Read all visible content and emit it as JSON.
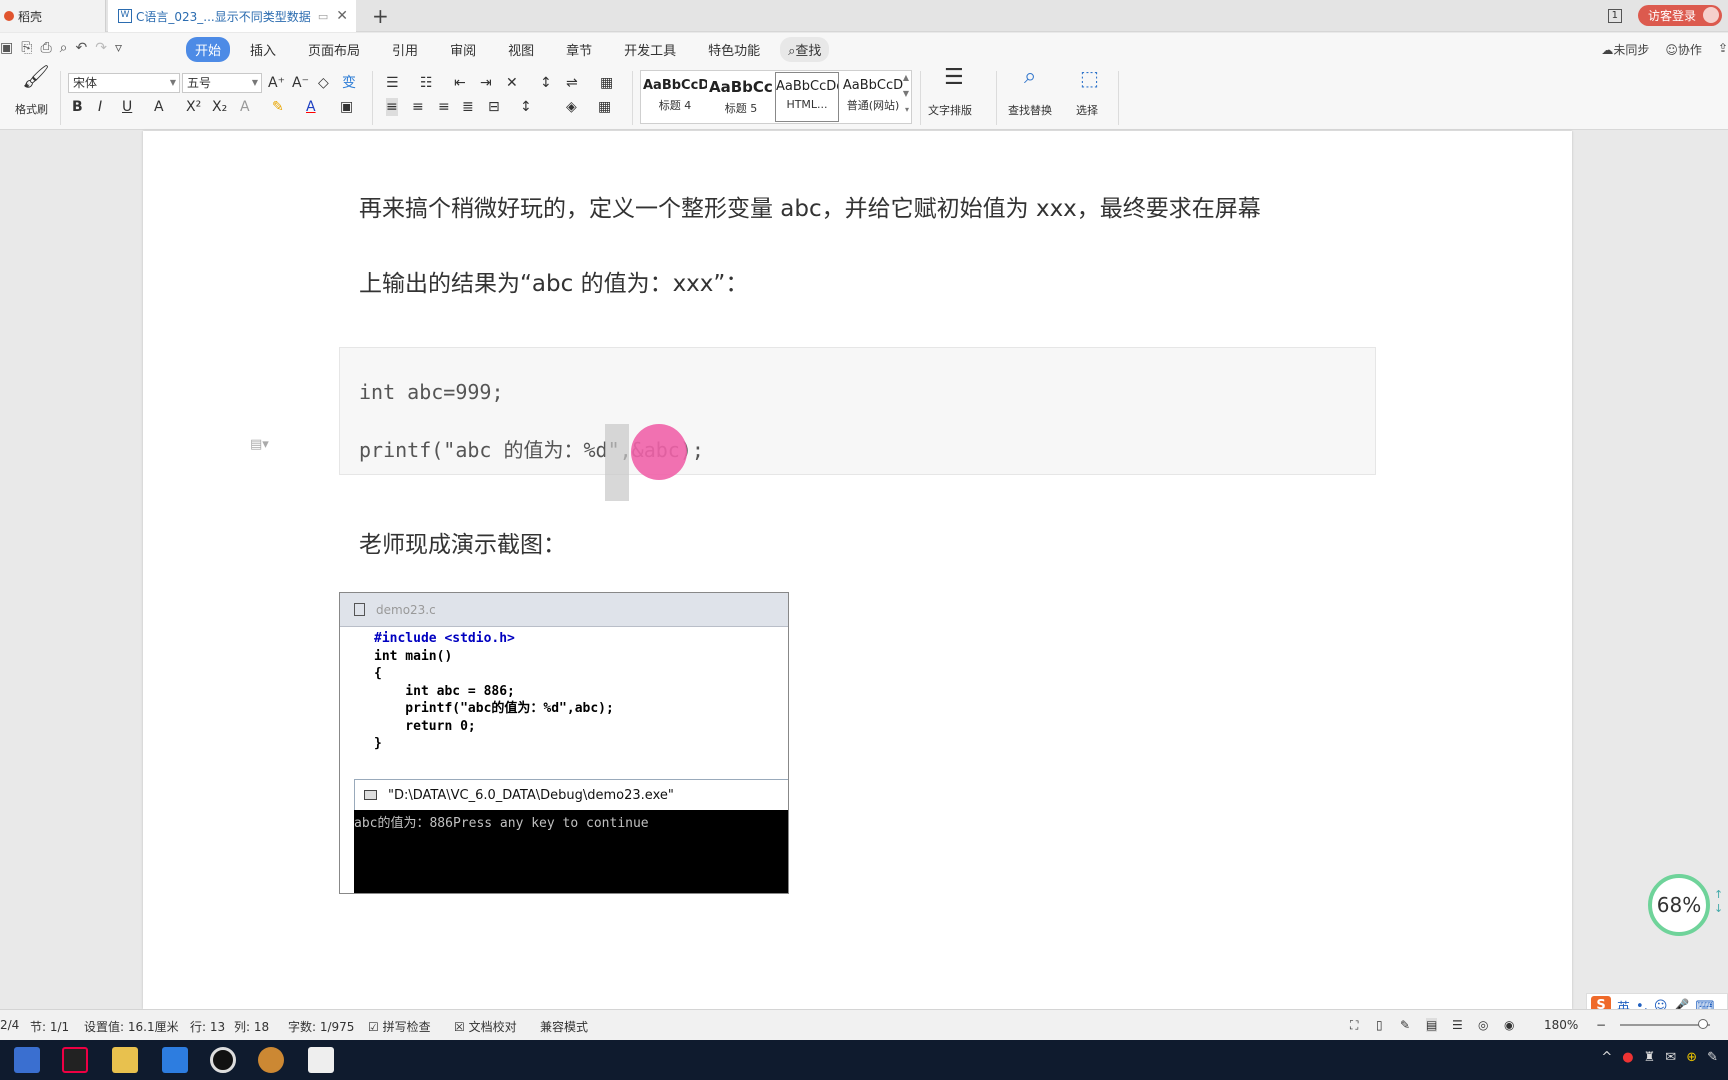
{
  "tabs": {
    "home": "稻壳",
    "doc": "C语言_023_...显示不同类型数据",
    "new": "+"
  },
  "topright": {
    "page_count": "1",
    "login": "访客登录"
  },
  "menubar": {
    "items": [
      "开始",
      "插入",
      "页面布局",
      "引用",
      "审阅",
      "视图",
      "章节",
      "开发工具",
      "特色功能"
    ],
    "search": "查找",
    "sync": "未同步",
    "collab": "协作"
  },
  "ribbon": {
    "format_painter": "格式刷",
    "font_name": "宋体",
    "font_size": "五号",
    "styles": [
      {
        "preview": "AaBbCcDd",
        "name": "标题 4"
      },
      {
        "preview": "AaBbCcDd",
        "name": "标题 5"
      },
      {
        "preview": "AaBbCcDd",
        "name": "HTML..."
      },
      {
        "preview": "AaBbCcD",
        "name": "普通(网站)"
      }
    ],
    "text_layout": "文字排版",
    "find_replace": "查找替换",
    "select": "选择"
  },
  "document": {
    "para1": "再来搞个稍微好玩的，定义一个整形变量 abc，并给它赋初始值为 xxx，最终要求在屏幕",
    "para2": "上输出的结果为“abc 的值为：xxx”：",
    "code_line1": "int abc=999;",
    "code_line2": "printf(\"abc 的值为：%d\",&abc);",
    "para3": "老师现成演示截图：",
    "screenshot": {
      "file_title": "demo23.c",
      "code": [
        "#include <stdio.h>",
        "int main()",
        "{",
        "    int abc = 886;",
        "    printf(\"abc的值为：%d\",abc);",
        "    return 0;",
        "}"
      ],
      "console_title": "\"D:\\DATA\\VC_6.0_DATA\\Debug\\demo23.exe\"",
      "console_output": "abc的值为：886Press any key to continue"
    }
  },
  "zoom_badge": "68%",
  "status": {
    "page": "2/4",
    "section": "节: 1/1",
    "setting": "设置值: 16.1厘米",
    "row": "行: 13",
    "col": "列: 18",
    "words": "字数: 1/975",
    "spell": "拼写检查",
    "proof": "文档校对",
    "compat": "兼容模式",
    "zoom": "180%"
  },
  "ime": {
    "lang": "英"
  },
  "colors": {
    "accent": "#4d8be6",
    "login": "#dc5a4e",
    "taskbar": "#0f1b2e"
  }
}
